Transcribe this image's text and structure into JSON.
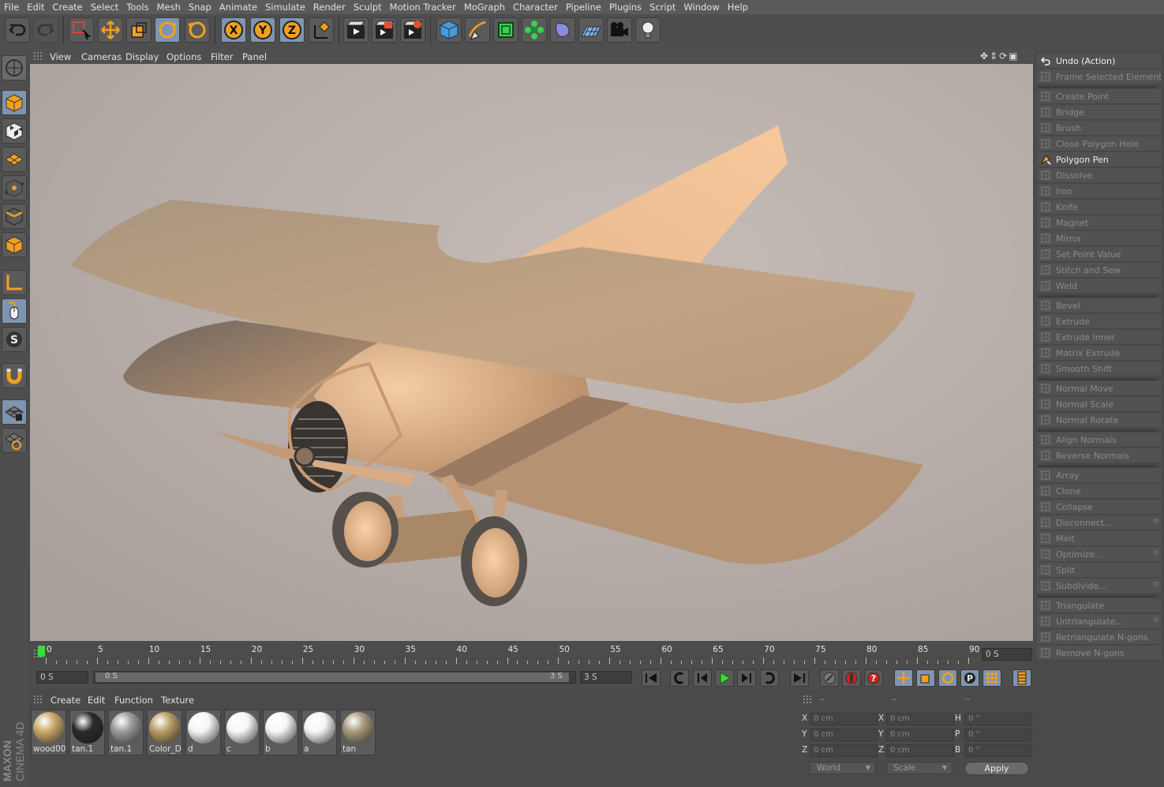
{
  "menubar": [
    "File",
    "Edit",
    "Create",
    "Select",
    "Tools",
    "Mesh",
    "Snap",
    "Animate",
    "Simulate",
    "Render",
    "Sculpt",
    "Motion Tracker",
    "MoGraph",
    "Character",
    "Pipeline",
    "Plugins",
    "Script",
    "Window",
    "Help"
  ],
  "toolbar_icons": [
    "undo-icon",
    "redo-icon",
    "live-selection-icon",
    "move-icon",
    "scale-icon",
    "rotate-icon",
    "recent-tool-icon",
    "x-axis-icon",
    "y-axis-icon",
    "z-axis-icon",
    "world-coordinates-icon",
    "render-view-icon",
    "render-to-picture-viewer-icon",
    "edit-render-settings-icon",
    "cube-icon",
    "pen-spline-icon",
    "subdivision-icon",
    "cloner-icon",
    "deformer-icon",
    "floor-icon",
    "camera-icon",
    "light-icon"
  ],
  "viewport": {
    "menu": [
      "View",
      "Cameras",
      "Display",
      "Options",
      "Filter",
      "Panel"
    ],
    "nav_icons": [
      "move-view-icon",
      "zoom-view-icon",
      "rotate-view-icon",
      "maximize-view-icon"
    ]
  },
  "right_panel": {
    "groups": [
      [
        {
          "label": "Undo (Action)",
          "enabled": true,
          "icon": "undo-icon"
        },
        {
          "label": "Frame Selected Elements",
          "enabled": false,
          "icon": "frame-icon"
        }
      ],
      [
        {
          "label": "Create Point",
          "enabled": false,
          "icon": "create-point-icon"
        },
        {
          "label": "Bridge",
          "enabled": false,
          "icon": "bridge-icon"
        },
        {
          "label": "Brush",
          "enabled": false,
          "icon": "brush-icon"
        },
        {
          "label": "Close Polygon Hole",
          "enabled": false,
          "icon": "close-hole-icon"
        },
        {
          "label": "Polygon Pen",
          "enabled": true,
          "icon": "polygon-pen-icon"
        },
        {
          "label": "Dissolve",
          "enabled": false,
          "icon": "dissolve-icon"
        },
        {
          "label": "Iron",
          "enabled": false,
          "icon": "iron-icon"
        },
        {
          "label": "Knife",
          "enabled": false,
          "icon": "knife-icon"
        },
        {
          "label": "Magnet",
          "enabled": false,
          "icon": "magnet-icon"
        },
        {
          "label": "Mirror",
          "enabled": false,
          "icon": "mirror-icon"
        },
        {
          "label": "Set Point Value",
          "enabled": false,
          "icon": "set-point-icon"
        },
        {
          "label": "Stitch and Sew",
          "enabled": false,
          "icon": "stitch-icon"
        },
        {
          "label": "Weld",
          "enabled": false,
          "icon": "weld-icon"
        }
      ],
      [
        {
          "label": "Bevel",
          "enabled": false,
          "icon": "bevel-icon"
        },
        {
          "label": "Extrude",
          "enabled": false,
          "icon": "extrude-icon"
        },
        {
          "label": "Extrude Inner",
          "enabled": false,
          "icon": "extrude-inner-icon"
        },
        {
          "label": "Matrix Extrude",
          "enabled": false,
          "icon": "matrix-extrude-icon"
        },
        {
          "label": "Smooth Shift",
          "enabled": false,
          "icon": "smooth-shift-icon"
        }
      ],
      [
        {
          "label": "Normal Move",
          "enabled": false,
          "icon": "normal-move-icon"
        },
        {
          "label": "Normal Scale",
          "enabled": false,
          "icon": "normal-scale-icon"
        },
        {
          "label": "Normal Rotate",
          "enabled": false,
          "icon": "normal-rotate-icon"
        }
      ],
      [
        {
          "label": "Align Normals",
          "enabled": false,
          "icon": "align-normals-icon"
        },
        {
          "label": "Reverse Normals",
          "enabled": false,
          "icon": "reverse-normals-icon"
        }
      ],
      [
        {
          "label": "Array",
          "enabled": false,
          "icon": "array-icon"
        },
        {
          "label": "Clone",
          "enabled": false,
          "icon": "clone-icon"
        },
        {
          "label": "Collapse",
          "enabled": false,
          "icon": "collapse-icon"
        },
        {
          "label": "Disconnect...",
          "enabled": false,
          "icon": "disconnect-icon",
          "options": true
        },
        {
          "label": "Melt",
          "enabled": false,
          "icon": "melt-icon"
        },
        {
          "label": "Optimize...",
          "enabled": false,
          "icon": "optimize-icon",
          "options": true
        },
        {
          "label": "Split",
          "enabled": false,
          "icon": "split-icon"
        },
        {
          "label": "Subdivide...",
          "enabled": false,
          "icon": "subdivide-icon",
          "options": true
        }
      ],
      [
        {
          "label": "Triangulate",
          "enabled": false,
          "icon": "triangulate-icon"
        },
        {
          "label": "Untriangulate...",
          "enabled": false,
          "icon": "untriangulate-icon",
          "options": true
        },
        {
          "label": "Retriangulate N-gons",
          "enabled": false,
          "icon": "retriangulate-icon"
        },
        {
          "label": "Remove N-gons",
          "enabled": false,
          "icon": "remove-ngons-icon"
        }
      ]
    ]
  },
  "timeline": {
    "ticks": [
      "0",
      "5",
      "10",
      "15",
      "20",
      "25",
      "30",
      "35",
      "40",
      "45",
      "50",
      "55",
      "60",
      "65",
      "70",
      "75",
      "80",
      "85",
      "90"
    ],
    "current_frame_field": "0 S",
    "start_field": "0 S",
    "range_start": "0 S",
    "range_end": "3 S",
    "end_field": "3 S"
  },
  "playback_icons": [
    "go-to-start-icon",
    "previous-key-icon",
    "previous-frame-icon",
    "play-icon",
    "next-frame-icon",
    "next-key-icon",
    "go-to-end-icon",
    "motion-record-icon",
    "record-active-objects-icon",
    "autokey-icon",
    "keyframe-selection-icon",
    "position-key-icon",
    "scale-key-icon",
    "rotation-key-icon",
    "parameter-key-icon",
    "pla-key-icon",
    "timeline-icon"
  ],
  "material_manager": {
    "menu": [
      "Create",
      "Edit",
      "Function",
      "Texture"
    ],
    "materials": [
      {
        "name": "wood00",
        "color": "#c8a868"
      },
      {
        "name": "tan.1",
        "color": "#2a2a2a"
      },
      {
        "name": "tan.1",
        "color": "#9a9a9a"
      },
      {
        "name": "Color_D",
        "color": "#b89c64"
      },
      {
        "name": "d",
        "color": "#f4f4f4"
      },
      {
        "name": "c",
        "color": "#f6f6f6"
      },
      {
        "name": "b",
        "color": "#f6f6f6"
      },
      {
        "name": "a",
        "color": "#f6f6f6"
      },
      {
        "name": "tan",
        "color": "#a8987c"
      }
    ]
  },
  "coordinates": {
    "headers": [
      "--",
      "--",
      "--"
    ],
    "rows": [
      {
        "axis_a": "X",
        "pos": "0 cm",
        "axis_b": "X",
        "size": "0 cm",
        "axis_c": "H",
        "rot": "0 °"
      },
      {
        "axis_a": "Y",
        "pos": "0 cm",
        "axis_b": "Y",
        "size": "0 cm",
        "axis_c": "P",
        "rot": "0 °"
      },
      {
        "axis_a": "Z",
        "pos": "0 cm",
        "axis_b": "Z",
        "size": "0 cm",
        "axis_c": "B",
        "rot": "0 °"
      }
    ],
    "mode_select": "World",
    "size_select": "Scale",
    "apply_label": "Apply"
  },
  "branding": {
    "company": "MAXON",
    "product": "CINEMA 4D"
  },
  "colors": {
    "accent_blue": "#7e95b0",
    "orange": "#f0a020",
    "play_green": "#3adb3a",
    "viewport_bg": "#b8ada9",
    "model_tan": "#d2a982"
  }
}
